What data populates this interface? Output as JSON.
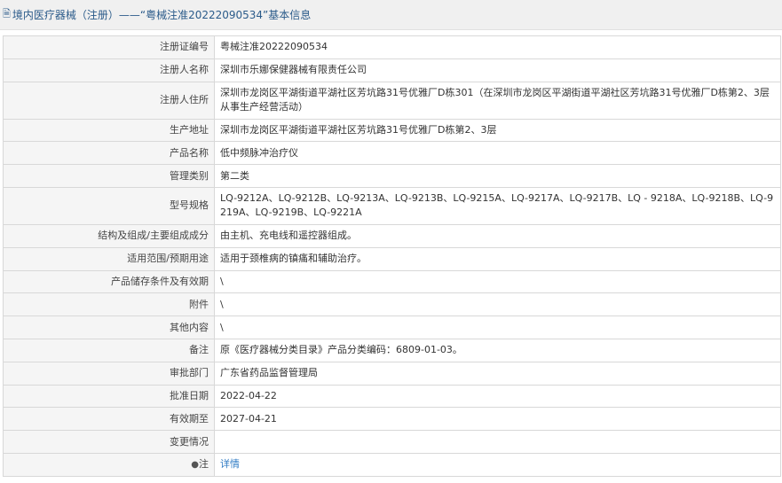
{
  "page": {
    "title": "境内医疗器械（注册）——“粤械注准20222090534”基本信息",
    "icon": "document-icon"
  },
  "rows": [
    {
      "label": "注册证编号",
      "value": "粤械注准20222090534"
    },
    {
      "label": "注册人名称",
      "value": "深圳市乐娜保健器械有限责任公司"
    },
    {
      "label": "注册人住所",
      "value": "深圳市龙岗区平湖街道平湖社区芳坑路31号优雅厂D栋301（在深圳市龙岗区平湖街道平湖社区芳坑路31号优雅厂D栋第2、3层从事生产经营活动）"
    },
    {
      "label": "生产地址",
      "value": "深圳市龙岗区平湖街道平湖社区芳坑路31号优雅厂D栋第2、3层"
    },
    {
      "label": "产品名称",
      "value": "低中频脉冲治疗仪"
    },
    {
      "label": "管理类别",
      "value": "第二类"
    },
    {
      "label": "型号规格",
      "value": "LQ-9212A、LQ-9212B、LQ-9213A、LQ-9213B、LQ-9215A、LQ-9217A、LQ-9217B、LQ - 9218A、LQ-9218B、LQ-9219A、LQ-9219B、LQ-9221A"
    },
    {
      "label": "结构及组成/主要组成成分",
      "value": "由主机、充电线和遥控器组成。"
    },
    {
      "label": "适用范围/预期用途",
      "value": "适用于颈椎病的镇痛和辅助治疗。"
    },
    {
      "label": "产品储存条件及有效期",
      "value": "\\"
    },
    {
      "label": "附件",
      "value": "\\"
    },
    {
      "label": "其他内容",
      "value": "\\"
    },
    {
      "label": "备注",
      "value": "原《医疗器械分类目录》产品分类编码：6809-01-03。"
    },
    {
      "label": "审批部门",
      "value": "广东省药品监督管理局"
    },
    {
      "label": "批准日期",
      "value": "2022-04-22"
    },
    {
      "label": "有效期至",
      "value": "2027-04-21"
    },
    {
      "label": "变更情况",
      "value": ""
    }
  ],
  "note_row": {
    "label": "注",
    "icon": "pin-icon",
    "link_text": "详情"
  },
  "colors": {
    "title_text": "#2b5b8a",
    "label_bg": "#f5f5f5",
    "border": "#d8d8d8",
    "link": "#2f7bc4"
  }
}
